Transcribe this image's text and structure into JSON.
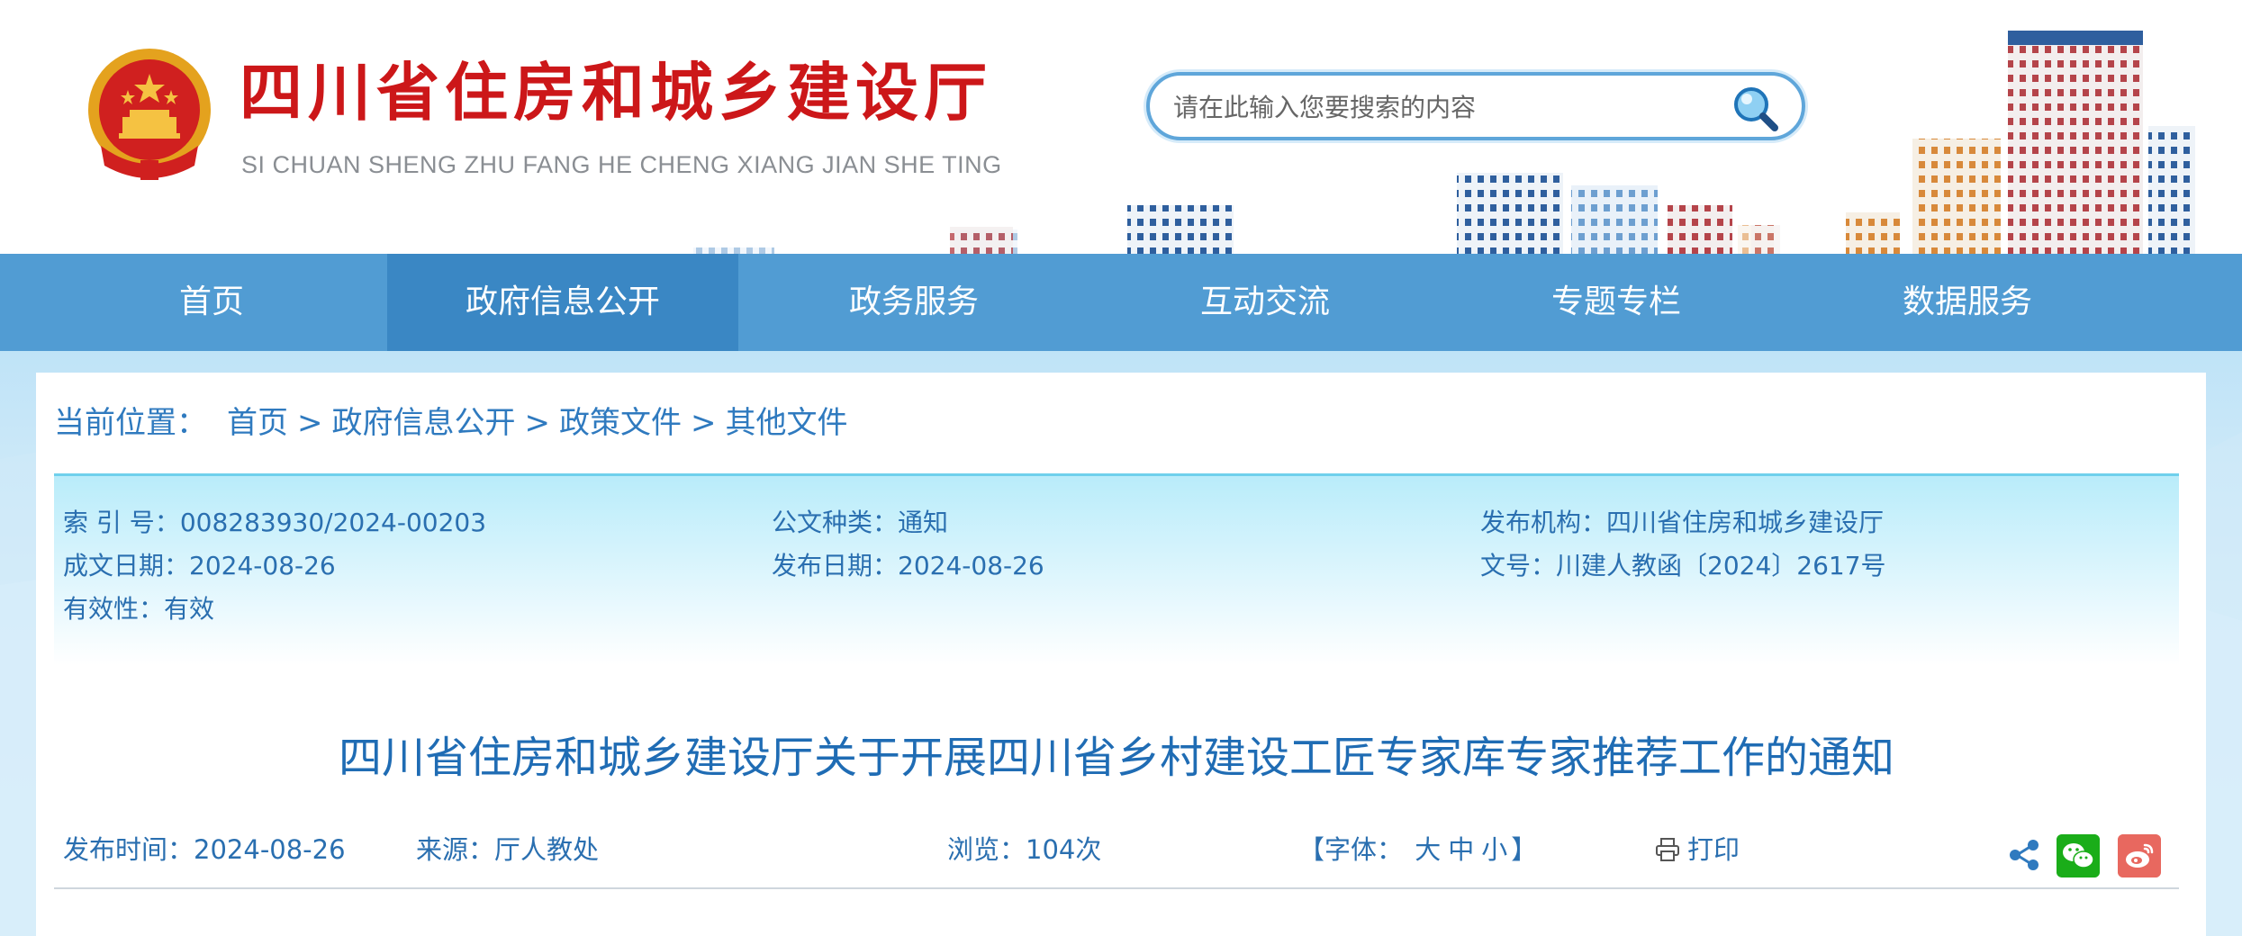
{
  "header": {
    "site_title": "四川省住房和城乡建设厅",
    "site_subtitle": "SI CHUAN SHENG ZHU FANG HE CHENG XIANG JIAN SHE TING",
    "search": {
      "placeholder": "请在此输入您要搜索的内容"
    }
  },
  "nav": {
    "items": [
      {
        "label": "首页"
      },
      {
        "label": "政府信息公开"
      },
      {
        "label": "政务服务"
      },
      {
        "label": "互动交流"
      },
      {
        "label": "专题专栏"
      },
      {
        "label": "数据服务"
      }
    ],
    "active_index": 1
  },
  "breadcrumb": {
    "label": "当前位置：",
    "items": [
      "首页",
      "政府信息公开",
      "政策文件",
      "其他文件"
    ],
    "separator": ">"
  },
  "meta": {
    "index_no": {
      "label": "索 引 号：",
      "value": "008283930/2024-00203"
    },
    "doc_type": {
      "label": "公文种类：",
      "value": "通知"
    },
    "publisher": {
      "label": "发布机构：",
      "value": "四川省住房和城乡建设厅"
    },
    "created_date": {
      "label": "成文日期：",
      "value": "2024-08-26"
    },
    "publish_date": {
      "label": "发布日期：",
      "value": "2024-08-26"
    },
    "doc_no": {
      "label": "文号：",
      "value": "川建人教函〔2024〕2617号"
    },
    "validity": {
      "label": "有效性：",
      "value": "有效"
    }
  },
  "article": {
    "title": "四川省住房和城乡建设厅关于开展四川省乡村建设工匠专家库专家推荐工作的通知",
    "publish_time": {
      "label": "发布时间：",
      "value": "2024-08-26"
    },
    "source": {
      "label": "来源：",
      "value": "厅人教处"
    },
    "views": {
      "label": "浏览：",
      "value": "104次"
    },
    "font_size": {
      "prefix": "【字体：",
      "large": "大",
      "medium": "中",
      "small": "小",
      "suffix": "】"
    },
    "print_label": "打印"
  },
  "colors": {
    "brand_red": "#cc1719",
    "nav_blue": "#348ccc",
    "link_blue": "#2f7abf",
    "wechat_green": "#1aad19",
    "weibo_red": "#e8685f"
  },
  "icons": [
    "national-emblem",
    "search-icon",
    "share-icon",
    "wechat-icon",
    "weibo-icon",
    "print-icon"
  ]
}
